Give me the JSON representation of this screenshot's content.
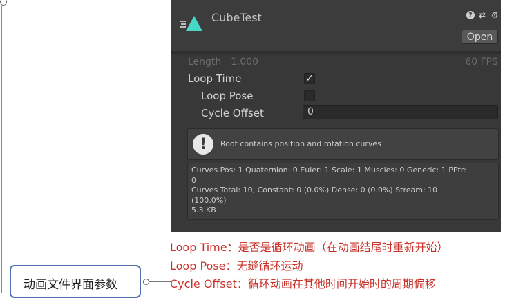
{
  "inspector": {
    "title": "CubeTest",
    "open_label": "Open",
    "header_icons": [
      "help-icon",
      "preset-sliders-icon",
      "settings-gear-icon"
    ],
    "length_label": "Length",
    "length_value": "1.000",
    "fps": "60 FPS",
    "loop_time_label": "Loop Time",
    "loop_time_checked": true,
    "loop_pose_label": "Loop Pose",
    "loop_pose_checked": false,
    "cycle_offset_label": "Cycle Offset",
    "cycle_offset_value": "0",
    "help_message": "Root contains position and rotation curves",
    "curve_info": [
      "Curves Pos: 1 Quaternion: 0 Euler: 1 Scale: 1 Muscles: 0 Generic: 1 PPtr:",
      "0",
      "Curves Total: 10, Constant: 0 (0.0%) Dense: 0 (0.0%) Stream: 10",
      "(100.0%)",
      "5.3 KB"
    ]
  },
  "annotations": {
    "loop_time": "Loop Time：是否是循环动画（在动画结尾时重新开始）",
    "loop_pose": "Loop Pose：无缝循环运动",
    "cycle_offset": "Cycle Offset：循环动画在其他时间开始时的周期偏移"
  },
  "tag": {
    "label": "动画文件界面参数"
  },
  "colors": {
    "panel_bg": "#383838",
    "annotation_red": "#c8312a",
    "tag_border": "#4f6fb5",
    "anim_icon_teal": "#46d7c8"
  }
}
